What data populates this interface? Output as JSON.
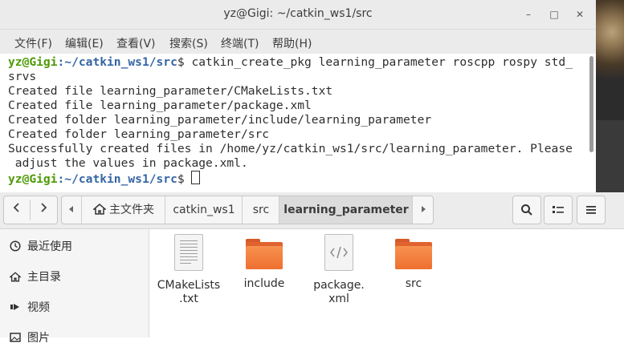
{
  "terminal": {
    "title": "yz@Gigi: ~/catkin_ws1/src",
    "menu": [
      "文件(F)",
      "编辑(E)",
      "查看(V)",
      "搜索(S)",
      "终端(T)",
      "帮助(H)"
    ],
    "prompt_user": "yz@Gigi",
    "prompt_path": ":~/catkin_ws1/src",
    "prompt_symbol": "$",
    "command_line1": " catkin_create_pkg learning_parameter roscpp rospy std_",
    "command_line2": "srvs",
    "output": [
      "Created file learning_parameter/CMakeLists.txt",
      "Created file learning_parameter/package.xml",
      "Created folder learning_parameter/include/learning_parameter",
      "Created folder learning_parameter/src",
      "Successfully created files in /home/yz/catkin_ws1/src/learning_parameter. Please",
      " adjust the values in package.xml."
    ]
  },
  "file_manager": {
    "breadcrumbs": [
      "主文件夹",
      "catkin_ws1",
      "src",
      "learning_parameter"
    ],
    "sidebar": [
      {
        "icon": "clock-icon",
        "label": "最近使用"
      },
      {
        "icon": "home-icon",
        "label": "主目录"
      },
      {
        "icon": "video-icon",
        "label": "视频"
      },
      {
        "icon": "picture-icon",
        "label": "图片"
      }
    ],
    "files": [
      {
        "name_line1": "CMakeLists",
        "name_line2": ".txt",
        "type": "text-file"
      },
      {
        "name_line1": "include",
        "name_line2": "",
        "type": "folder"
      },
      {
        "name_line1": "package.",
        "name_line2": "xml",
        "type": "xml-file"
      },
      {
        "name_line1": "src",
        "name_line2": "",
        "type": "folder"
      }
    ]
  }
}
